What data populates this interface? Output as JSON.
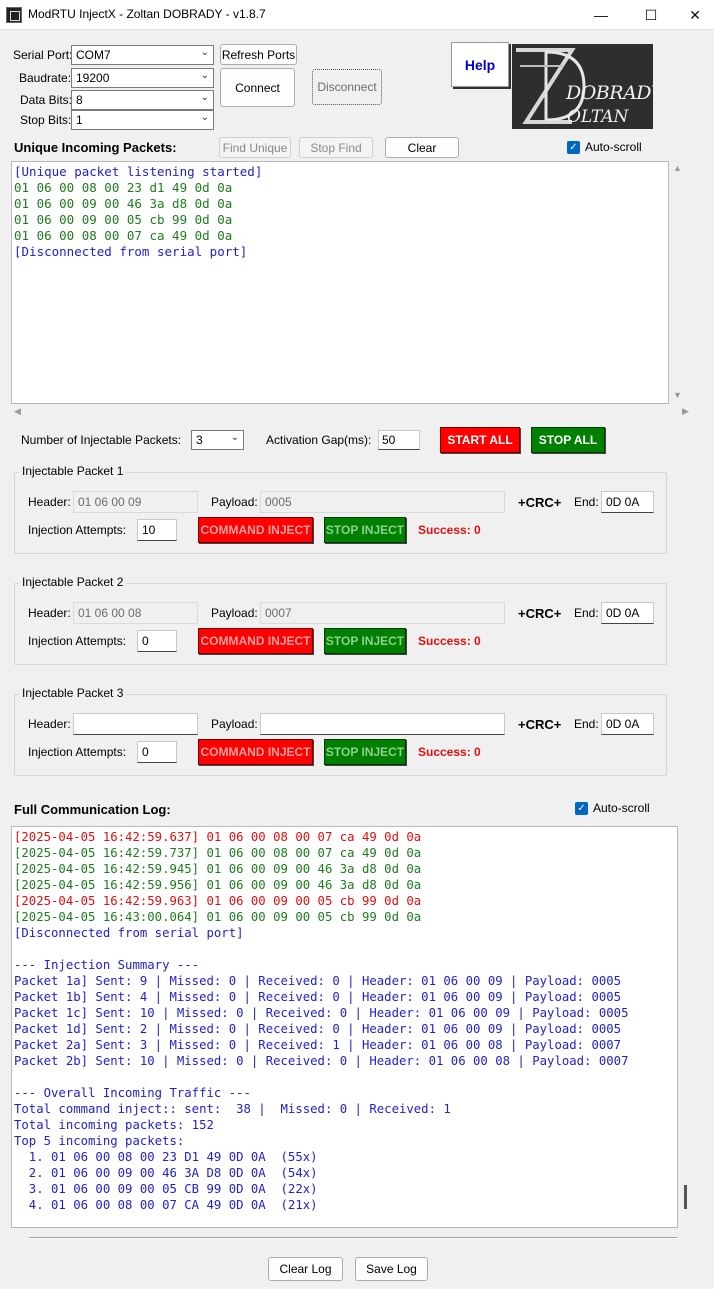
{
  "window": {
    "title": "ModRTU InjectX - Zoltan DOBRADY - v1.8.7",
    "minimize": "—",
    "maximize": "☐",
    "close": "✕"
  },
  "serial": {
    "port_label": "Serial Port:",
    "port_value": "COM7",
    "baud_label": "Baudrate:",
    "baud_value": "19200",
    "databits_label": "Data Bits:",
    "databits_value": "8",
    "stopbits_label": "Stop Bits:",
    "stopbits_value": "1",
    "refresh_label": "Refresh Ports",
    "connect_label": "Connect",
    "disconnect_label": "Disconnect"
  },
  "help_label": "Help",
  "logo": {
    "line1": "DOBRADY",
    "line2": "OLTAN",
    "big_letter": "Z",
    "big_letter2": "D"
  },
  "unique": {
    "title": "Unique Incoming Packets:",
    "find_unique_label": "Find Unique",
    "stop_find_label": "Stop Find",
    "clear_label": "Clear",
    "autoscroll_label": "Auto-scroll",
    "lines": [
      {
        "text": "[Unique packet listening started]",
        "color": "blue"
      },
      {
        "text": "01 06 00 08 00 23 d1 49 0d 0a",
        "color": "green"
      },
      {
        "text": "01 06 00 09 00 46 3a d8 0d 0a",
        "color": "green"
      },
      {
        "text": "01 06 00 09 00 05 cb 99 0d 0a",
        "color": "green"
      },
      {
        "text": "01 06 00 08 00 07 ca 49 0d 0a",
        "color": "green"
      },
      {
        "text": "[Disconnected from serial port]",
        "color": "blue"
      }
    ]
  },
  "controls": {
    "num_label": "Number of Injectable Packets:",
    "num_value": "3",
    "gap_label": "Activation Gap(ms):",
    "gap_value": "50",
    "start_all_label": "START ALL",
    "stop_all_label": "STOP ALL"
  },
  "packets": [
    {
      "title": "Injectable Packet 1",
      "header_label": "Header:",
      "header_value": "01 06 00 09",
      "payload_label": "Payload:",
      "payload_value": "0005",
      "crc_label": "+CRC+",
      "end_label": "End:",
      "end_value": "0D 0A",
      "attempts_label": "Injection Attempts:",
      "attempts_value": "10",
      "command_inject_label": "COMMAND INJECT",
      "stop_inject_label": "STOP INJECT",
      "success_label": "Success: 0"
    },
    {
      "title": "Injectable Packet 2",
      "header_label": "Header:",
      "header_value": "01 06 00 08",
      "payload_label": "Payload:",
      "payload_value": "0007",
      "crc_label": "+CRC+",
      "end_label": "End:",
      "end_value": "0D 0A",
      "attempts_label": "Injection Attempts:",
      "attempts_value": "0",
      "command_inject_label": "COMMAND INJECT",
      "stop_inject_label": "STOP INJECT",
      "success_label": "Success: 0"
    },
    {
      "title": "Injectable Packet 3",
      "header_label": "Header:",
      "header_value": "",
      "payload_label": "Payload:",
      "payload_value": "",
      "crc_label": "+CRC+",
      "end_label": "End:",
      "end_value": "0D 0A",
      "attempts_label": "Injection Attempts:",
      "attempts_value": "0",
      "command_inject_label": "COMMAND INJECT",
      "stop_inject_label": "STOP INJECT",
      "success_label": "Success: 0"
    }
  ],
  "log": {
    "title": "Full Communication Log:",
    "autoscroll_label": "Auto-scroll",
    "lines": [
      {
        "text": "[2025-04-05 16:42:59.637] 01 06 00 08 00 07 ca 49 0d 0a",
        "color": "red"
      },
      {
        "text": "[2025-04-05 16:42:59.737] 01 06 00 08 00 07 ca 49 0d 0a",
        "color": "green"
      },
      {
        "text": "[2025-04-05 16:42:59.945] 01 06 00 09 00 46 3a d8 0d 0a",
        "color": "green"
      },
      {
        "text": "[2025-04-05 16:42:59.956] 01 06 00 09 00 46 3a d8 0d 0a",
        "color": "green"
      },
      {
        "text": "[2025-04-05 16:42:59.963] 01 06 00 09 00 05 cb 99 0d 0a",
        "color": "red"
      },
      {
        "text": "[2025-04-05 16:43:00.064] 01 06 00 09 00 05 cb 99 0d 0a",
        "color": "green"
      },
      {
        "text": "[Disconnected from serial port]",
        "color": "blue"
      },
      {
        "text": "",
        "color": "blue"
      },
      {
        "text": "--- Injection Summary ---",
        "color": "blue"
      },
      {
        "text": "Packet 1a] Sent: 9 | Missed: 0 | Received: 0 | Header: 01 06 00 09 | Payload: 0005",
        "color": "blue"
      },
      {
        "text": "Packet 1b] Sent: 4 | Missed: 0 | Received: 0 | Header: 01 06 00 09 | Payload: 0005",
        "color": "blue"
      },
      {
        "text": "Packet 1c] Sent: 10 | Missed: 0 | Received: 0 | Header: 01 06 00 09 | Payload: 0005",
        "color": "blue"
      },
      {
        "text": "Packet 1d] Sent: 2 | Missed: 0 | Received: 0 | Header: 01 06 00 09 | Payload: 0005",
        "color": "blue"
      },
      {
        "text": "Packet 2a] Sent: 3 | Missed: 0 | Received: 1 | Header: 01 06 00 08 | Payload: 0007",
        "color": "blue"
      },
      {
        "text": "Packet 2b] Sent: 10 | Missed: 0 | Received: 0 | Header: 01 06 00 08 | Payload: 0007",
        "color": "blue"
      },
      {
        "text": "",
        "color": "blue"
      },
      {
        "text": "--- Overall Incoming Traffic ---",
        "color": "blue"
      },
      {
        "text": "Total command inject:: sent:  38 |  Missed: 0 | Received: 1",
        "color": "blue"
      },
      {
        "text": "Total incoming packets: 152",
        "color": "blue"
      },
      {
        "text": "Top 5 incoming packets:",
        "color": "blue"
      },
      {
        "text": "  1. 01 06 00 08 00 23 D1 49 0D 0A  (55x)",
        "color": "blue"
      },
      {
        "text": "  2. 01 06 00 09 00 46 3A D8 0D 0A  (54x)",
        "color": "blue"
      },
      {
        "text": "  3. 01 06 00 09 00 05 CB 99 0D 0A  (22x)",
        "color": "blue"
      },
      {
        "text": "  4. 01 06 00 08 00 07 CA 49 0D 0A  (21x)",
        "color": "blue"
      }
    ],
    "clear_log_label": "Clear Log",
    "save_log_label": "Save Log"
  },
  "colors": {
    "green": "#1e7c1e",
    "blue": "#2222cc",
    "red": "#e01010",
    "accent": "#0067c0"
  }
}
